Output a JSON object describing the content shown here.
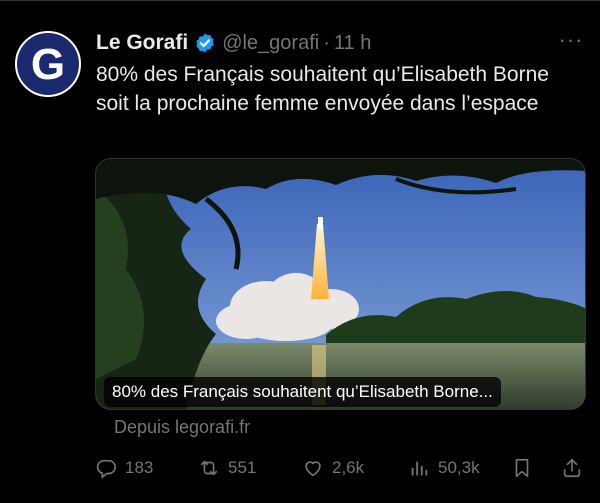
{
  "tweet": {
    "avatar_letter": "G",
    "author": "Le Gorafi",
    "handle": "@le_gorafi",
    "separator": "·",
    "time": "11 h",
    "more_label": "···",
    "text": "80% des Français souhaitent qu’Elisabeth Borne soit la prochaine femme envoyée dans l’espace"
  },
  "card": {
    "title": "80% des Français souhaitent qu’Elisabeth Borne...",
    "source": "Depuis legorafi.fr"
  },
  "actions": {
    "replies": "183",
    "reposts": "551",
    "likes": "2,6k",
    "views": "50,3k"
  },
  "colors": {
    "background": "#000000",
    "text": "#e7e9ea",
    "muted": "#71767b",
    "verified": "#1d9bf0",
    "avatar": "#1b2a6e"
  },
  "icons": {
    "verified": "verified-badge-icon",
    "more": "more-icon",
    "reply": "reply-icon",
    "repost": "repost-icon",
    "like": "like-icon",
    "views": "views-icon",
    "bookmark": "bookmark-icon",
    "share": "share-icon"
  }
}
